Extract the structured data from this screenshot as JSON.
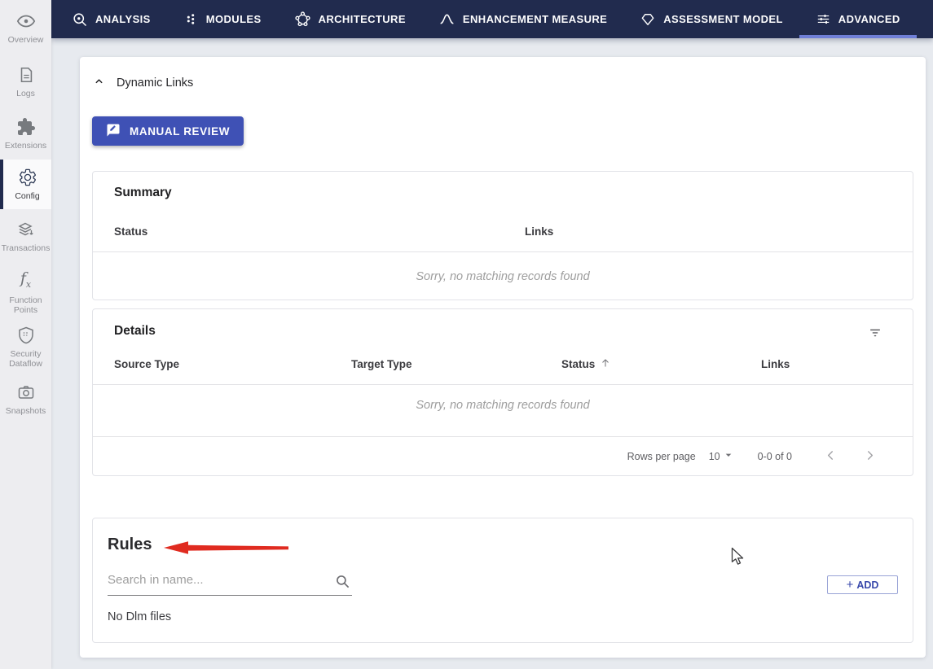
{
  "navbar": {
    "tabs": [
      {
        "label": "ANALYSIS",
        "icon": "magnifier-code-icon",
        "active": false
      },
      {
        "label": "MODULES",
        "icon": "dots-grid-icon",
        "active": false
      },
      {
        "label": "ARCHITECTURE",
        "icon": "network-nodes-icon",
        "active": false
      },
      {
        "label": "ENHANCEMENT MEASURE",
        "icon": "curve-peak-icon",
        "active": false
      },
      {
        "label": "ASSESSMENT MODEL",
        "icon": "diamond-icon",
        "active": false
      },
      {
        "label": "ADVANCED",
        "icon": "tune-sliders-icon",
        "active": true
      }
    ],
    "active_tab": "ADVANCED"
  },
  "sidebar": {
    "items": [
      {
        "label": "Overview",
        "icon": "eye-icon",
        "active": false
      },
      {
        "label": "Logs",
        "icon": "document-icon",
        "active": false
      },
      {
        "label": "Extensions",
        "icon": "puzzle-icon",
        "active": false
      },
      {
        "label": "Config",
        "icon": "gear-icon",
        "active": true
      },
      {
        "label": "Transactions",
        "icon": "layers-down-icon",
        "active": false
      },
      {
        "label": "Function Points",
        "icon": "fx-icon",
        "active": false
      },
      {
        "label": "Security Dataflow",
        "icon": "shield-icon",
        "active": false
      },
      {
        "label": "Snapshots",
        "icon": "camera-icon",
        "active": false
      }
    ],
    "active_item": "Config"
  },
  "main": {
    "section_title": "Dynamic Links",
    "manual_review": {
      "label": "MANUAL REVIEW",
      "icon": "rate-review-icon"
    },
    "summary": {
      "title": "Summary",
      "columns": [
        "Status",
        "Links"
      ],
      "empty_message": "Sorry, no matching records found"
    },
    "details": {
      "title": "Details",
      "columns": [
        "Source Type",
        "Target Type",
        "Status",
        "Links"
      ],
      "sort": {
        "column": "Status",
        "direction": "ascending"
      },
      "empty_message": "Sorry, no matching records found",
      "pagination": {
        "label": "Rows per page",
        "value": "10",
        "range": "0-0 of 0"
      }
    },
    "rules": {
      "title": "Rules",
      "search_placeholder": "Search in name...",
      "add_plus": "+",
      "add_label": "ADD",
      "empty_message": "No Dlm files"
    }
  },
  "colors": {
    "navbar_background": "#212b4e",
    "active_tab_underline": "#6f7fd8",
    "primary_button": "#3f51b5",
    "annotation_arrow": "#e02b20",
    "page_background": "#e7eaef"
  }
}
